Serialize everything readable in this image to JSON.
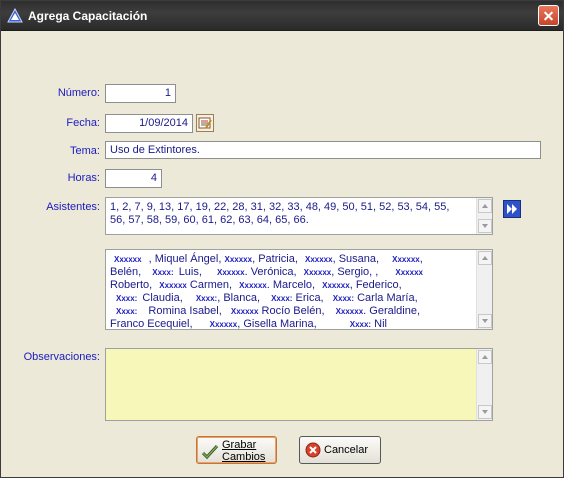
{
  "window": {
    "title": "Agrega Capacitación"
  },
  "form": {
    "numero": {
      "label": "Número:",
      "value": "1"
    },
    "fecha": {
      "label": "Fecha:",
      "value": "1/09/2014"
    },
    "tema": {
      "label": "Tema:",
      "value": "Uso de Extintores."
    },
    "horas": {
      "label": "Horas:",
      "value": "4"
    },
    "asistentes": {
      "label": "Asistentes:",
      "ids_line1": "1, 2, 7, 9, 13, 17, 19, 22, 28, 31, 32, 33, 48, 49, 50, 51, 52, 53, 54, 55,",
      "ids_line2": "56, 57, 58, 59, 60, 61, 62, 63, 64, 65, 66."
    },
    "names": {
      "mask": "Xxxxxx",
      "mask_short": "Xxxx:",
      "l1": [
        ", Miquel Ángel,",
        ", Patricia,",
        ", Susana,",
        ","
      ],
      "l2": [
        "Belén,",
        "Luis,",
        ". Verónica,",
        ", Sergio,",
        ","
      ],
      "l3": [
        "Roberto,",
        "Carmen,",
        ". Marcelo,",
        ", Federico,"
      ],
      "l4": [
        "Claudia,",
        ", Blanca,",
        "Erica,",
        "Carla María,"
      ],
      "l5": [
        "Romina Isabel,",
        "Rocío Belén,",
        ". Geraldine,"
      ],
      "l6": [
        "Franco Ecequiel,",
        ", Gisella Marina,",
        "Nil"
      ]
    },
    "observaciones": {
      "label": "Observaciones:",
      "value": ""
    }
  },
  "buttons": {
    "grabar_line1": "Grabar",
    "grabar_line2": "Cambios",
    "cancelar": "Cancelar"
  },
  "colors": {
    "label": "#1b1bbf",
    "value_text": "#1a1a8a",
    "memo_yellow": "#f7f7b9",
    "titlebar": "#2e2e2e"
  }
}
